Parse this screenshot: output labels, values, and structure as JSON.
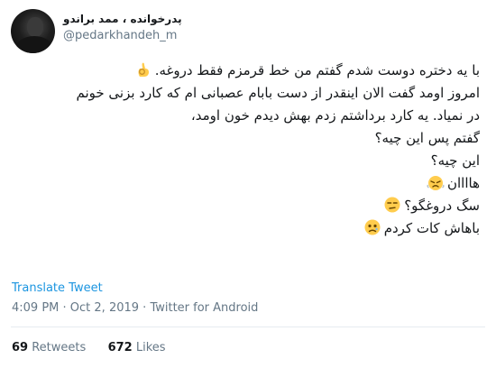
{
  "author": {
    "display_name": "پدرخوانده ، ممد براندو",
    "handle": "@pedarkhandeh_m"
  },
  "tweet": {
    "lines": [
      "با یه دختره دوست شدم گفتم من خط قرمزم فقط دروغه.",
      "امروز اومد گفت الان اینقدر از دست بابام عصبانی ام که کارد بزنی خونم",
      "در نمیاد. یه کارد برداشتم زدم بهش دیدم خون اومد،",
      "گفتم پس این چیه؟",
      "این چیه؟",
      "هاااان",
      "سگ دروغگو؟",
      "باهاش کات کردم"
    ],
    "emojis": [
      "ok-hand-icon",
      "angry-steam-face-icon",
      "unamused-face-icon",
      "woozy-face-icon"
    ]
  },
  "actions": {
    "translate_label": "Translate Tweet"
  },
  "meta": {
    "time": "4:09 PM",
    "sep1": " · ",
    "date": "Oct 2, 2019",
    "sep2": " · ",
    "source": "Twitter for Android"
  },
  "stats": {
    "retweets_count": "69",
    "retweets_label": "Retweets",
    "likes_count": "672",
    "likes_label": "Likes"
  },
  "colors": {
    "link": "#1b95e0",
    "muted": "#657786",
    "text": "#14171a",
    "divider": "#e6ecf0",
    "emoji": "#ffcc4d"
  }
}
